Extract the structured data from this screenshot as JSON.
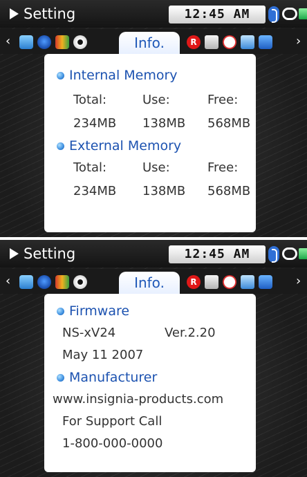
{
  "screens": [
    {
      "status": {
        "title": "Setting",
        "time": "12:45 AM"
      },
      "tabs": {
        "left_arrow": "‹",
        "right_arrow": "›",
        "active_label": "Info."
      },
      "sections": [
        {
          "title": "Internal Memory",
          "headers": [
            "Total:",
            "Use:",
            "Free:"
          ],
          "values": [
            "234MB",
            "138MB",
            "568MB"
          ]
        },
        {
          "title": "External Memory",
          "headers": [
            "Total:",
            "Use:",
            "Free:"
          ],
          "values": [
            "234MB",
            "138MB",
            "568MB"
          ]
        }
      ]
    },
    {
      "status": {
        "title": "Setting",
        "time": "12:45 AM"
      },
      "tabs": {
        "left_arrow": "‹",
        "right_arrow": "›",
        "active_label": "Info."
      },
      "firmware": {
        "title": "Firmware",
        "model": "NS-xV24",
        "version": "Ver.2.20",
        "date": "May 11 2007"
      },
      "manufacturer": {
        "title": "Manufacturer",
        "website": "www.insignia-products.com",
        "support": "For Support Call",
        "phone": "1-800-000-0000"
      }
    }
  ],
  "icons": [
    "play-icon",
    "bluetooth-icon",
    "repeat-icon",
    "battery-icon",
    "music-icon",
    "photo-icon",
    "disc-icon",
    "record-icon",
    "card-icon",
    "clock-icon",
    "screen-icon",
    "sync-icon"
  ],
  "colors": {
    "accent_blue": "#1c52b0",
    "background": "#1c1c1c",
    "panel": "#ffffff",
    "text": "#333333"
  }
}
